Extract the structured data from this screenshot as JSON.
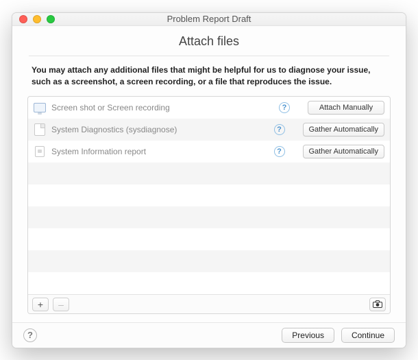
{
  "window": {
    "title": "Problem Report Draft"
  },
  "page": {
    "title": "Attach files",
    "instructions": "You may attach any additional files that might be helpful for us to diagnose your issue, such as a screenshot, a screen recording, or a file that reproduces the issue."
  },
  "attachments": {
    "rows": [
      {
        "icon": "monitor-icon",
        "label": "Screen shot or Screen recording",
        "action": "Attach Manually"
      },
      {
        "icon": "file-icon",
        "label": "System Diagnostics (sysdiagnose)",
        "action": "Gather Automatically"
      },
      {
        "icon": "chip-icon",
        "label": "System Information report",
        "action": "Gather Automatically"
      }
    ],
    "blank_rows": 6,
    "toolbar": {
      "add": "+",
      "remove": "–"
    }
  },
  "footer": {
    "previous": "Previous",
    "continue": "Continue"
  },
  "glyphs": {
    "help": "?"
  }
}
